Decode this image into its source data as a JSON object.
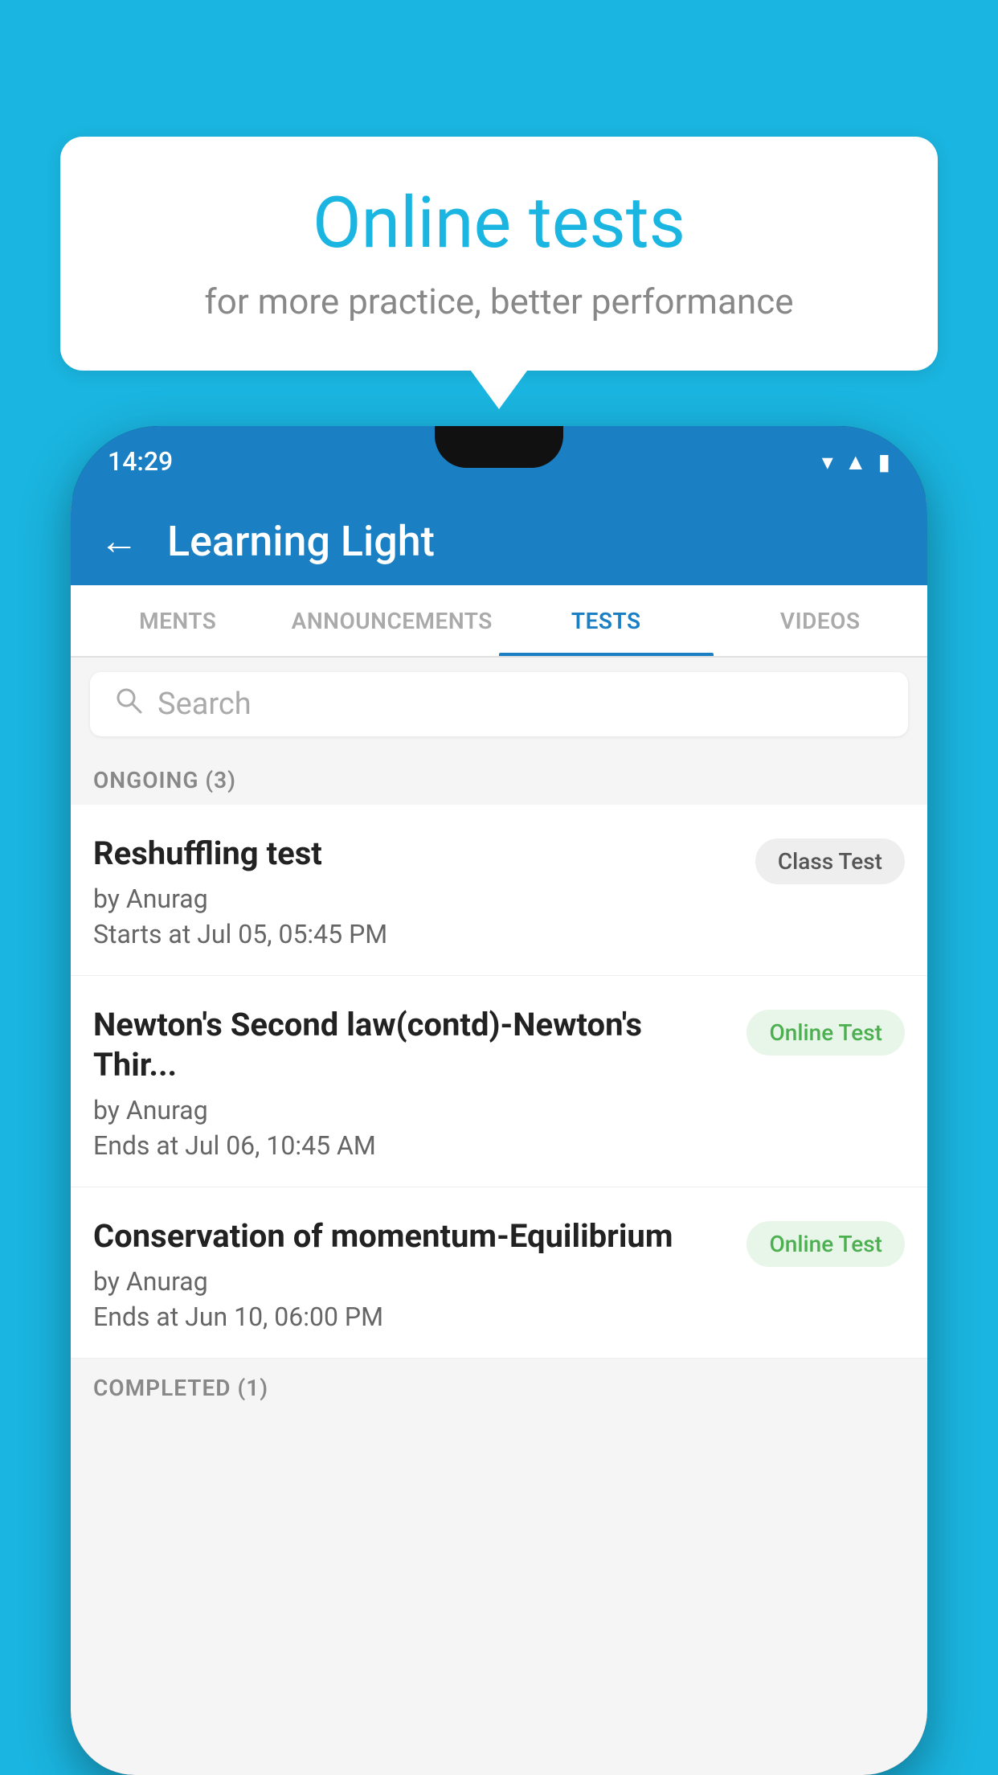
{
  "background_color": "#1ab5e0",
  "callout": {
    "title": "Online tests",
    "subtitle": "for more practice, better performance"
  },
  "phone": {
    "time": "14:29",
    "app_title": "Learning Light",
    "back_label": "←",
    "tabs": [
      {
        "id": "ments",
        "label": "MENTS",
        "active": false
      },
      {
        "id": "announcements",
        "label": "ANNOUNCEMENTS",
        "active": false
      },
      {
        "id": "tests",
        "label": "TESTS",
        "active": true
      },
      {
        "id": "videos",
        "label": "VIDEOS",
        "active": false
      }
    ],
    "search_placeholder": "Search",
    "sections": [
      {
        "id": "ongoing",
        "label": "ONGOING (3)",
        "tests": [
          {
            "id": "reshuffling",
            "name": "Reshuffling test",
            "author": "by Anurag",
            "time_label": "Starts at",
            "time_value": "Jul 05, 05:45 PM",
            "badge": "Class Test",
            "badge_type": "class"
          },
          {
            "id": "newtons-second",
            "name": "Newton's Second law(contd)-Newton's Thir...",
            "author": "by Anurag",
            "time_label": "Ends at",
            "time_value": "Jul 06, 10:45 AM",
            "badge": "Online Test",
            "badge_type": "online"
          },
          {
            "id": "conservation",
            "name": "Conservation of momentum-Equilibrium",
            "author": "by Anurag",
            "time_label": "Ends at",
            "time_value": "Jun 10, 06:00 PM",
            "badge": "Online Test",
            "badge_type": "online"
          }
        ]
      }
    ],
    "completed_label": "COMPLETED (1)"
  }
}
